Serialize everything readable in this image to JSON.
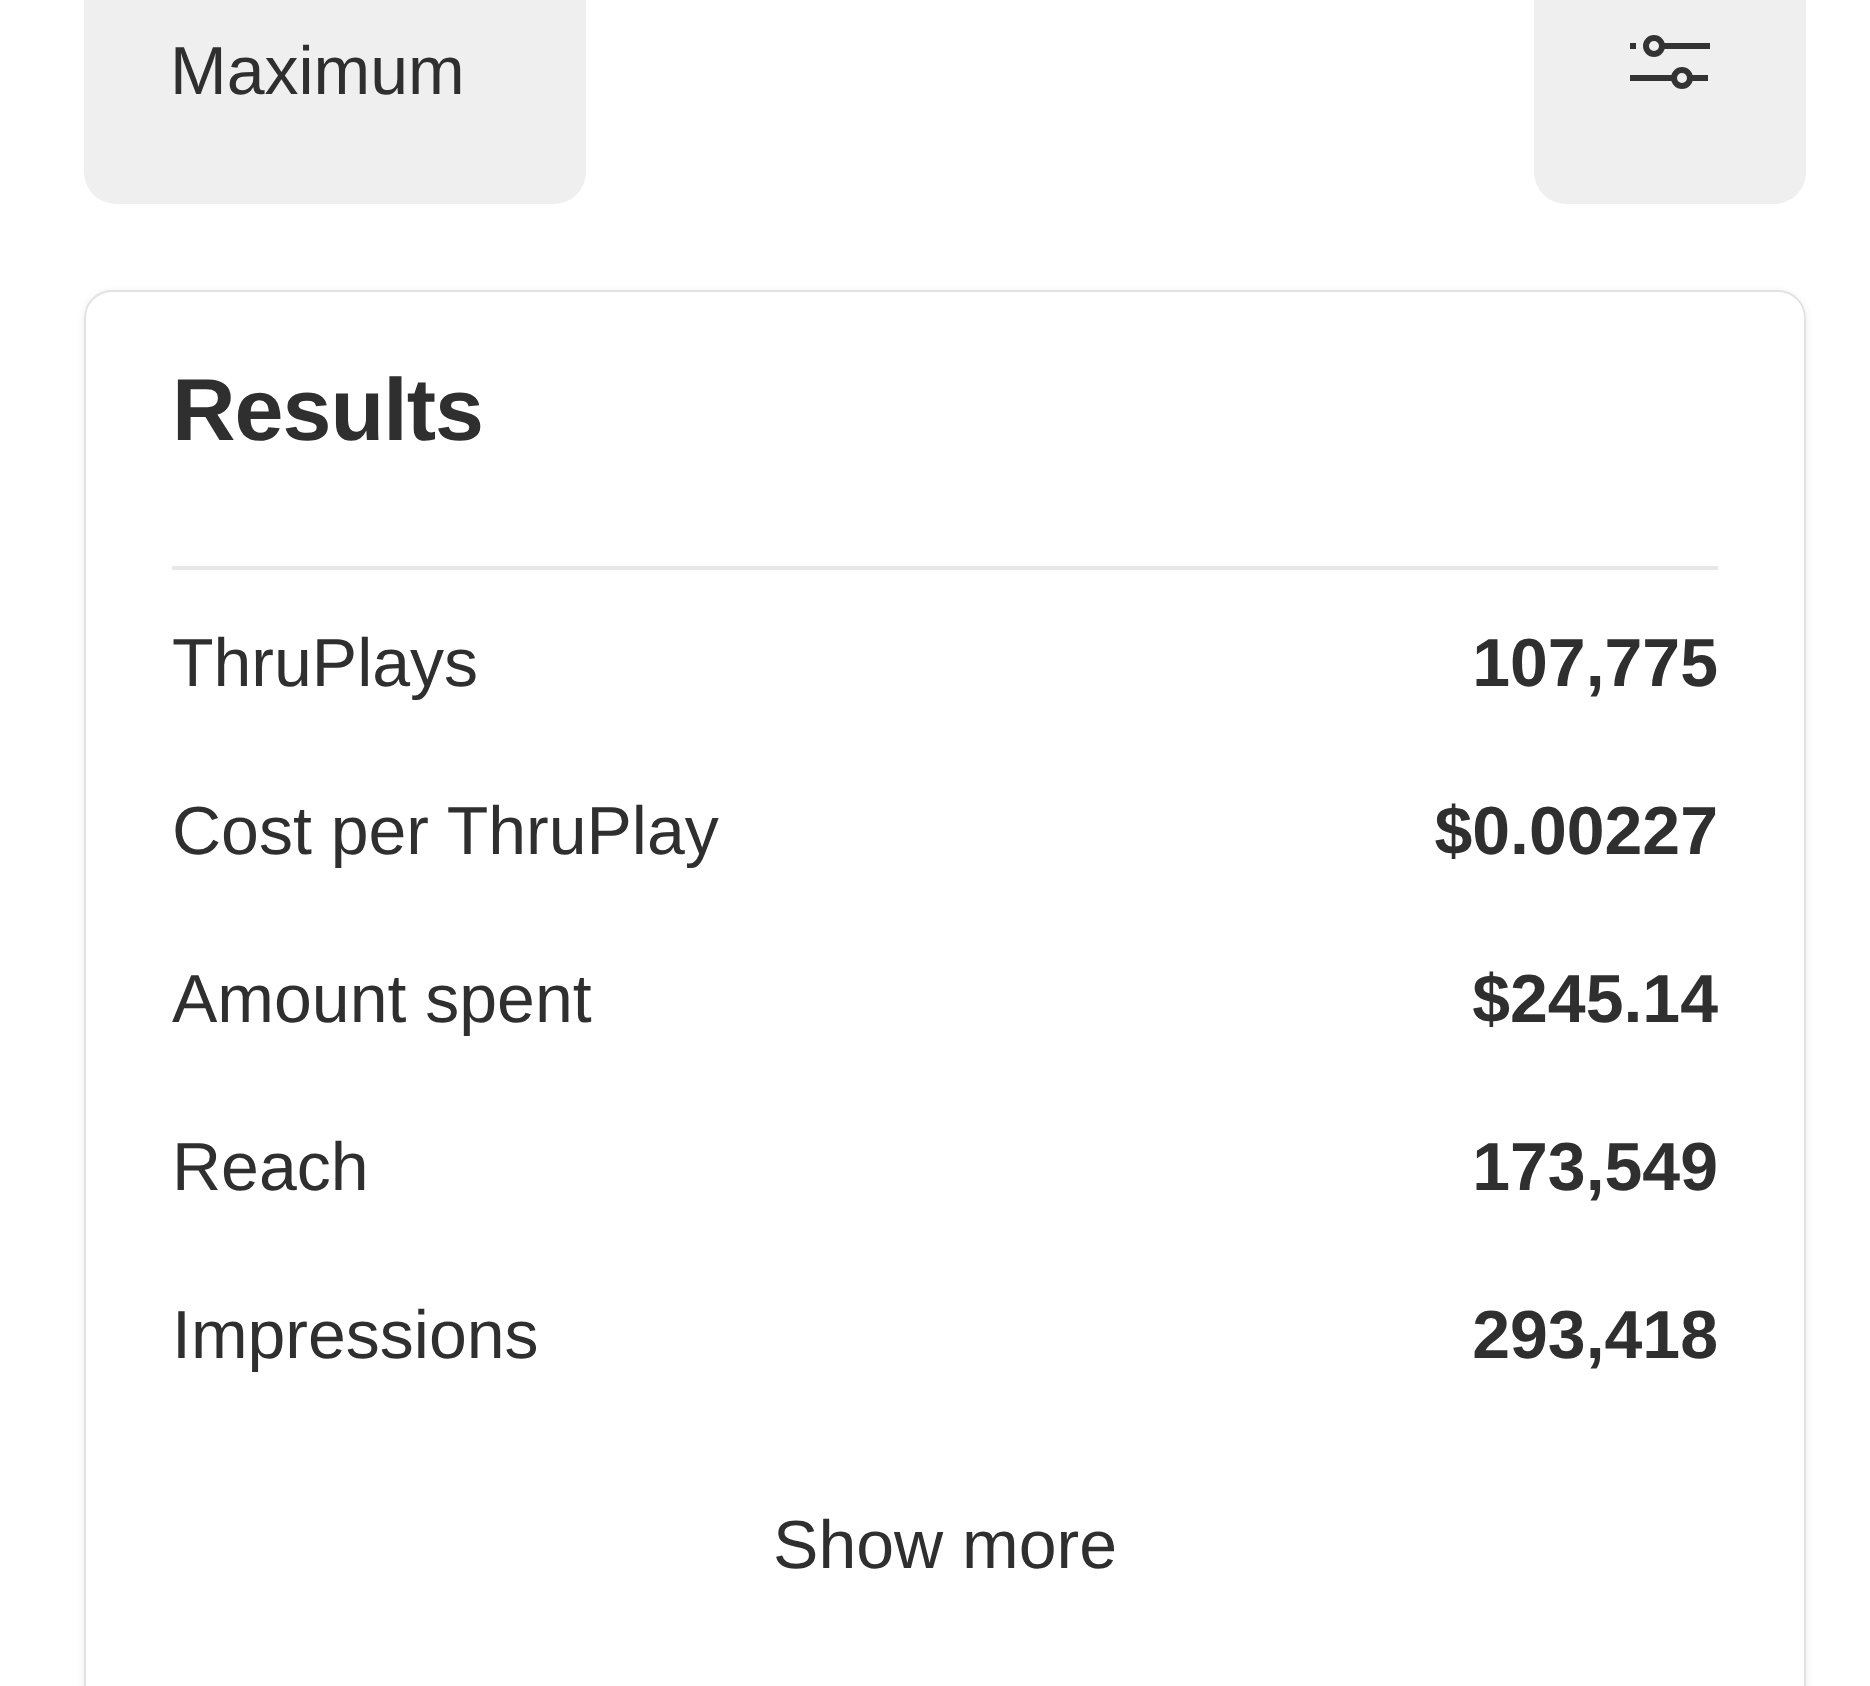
{
  "top_bar": {
    "selector_label": "Maximum"
  },
  "results": {
    "title": "Results",
    "rows": [
      {
        "label": "ThruPlays",
        "value": "107,775"
      },
      {
        "label": "Cost per ThruPlay",
        "value": "$0.00227"
      },
      {
        "label": "Amount spent",
        "value": "$245.14"
      },
      {
        "label": "Reach",
        "value": "173,549"
      },
      {
        "label": "Impressions",
        "value": "293,418"
      }
    ],
    "show_more": "Show more"
  }
}
